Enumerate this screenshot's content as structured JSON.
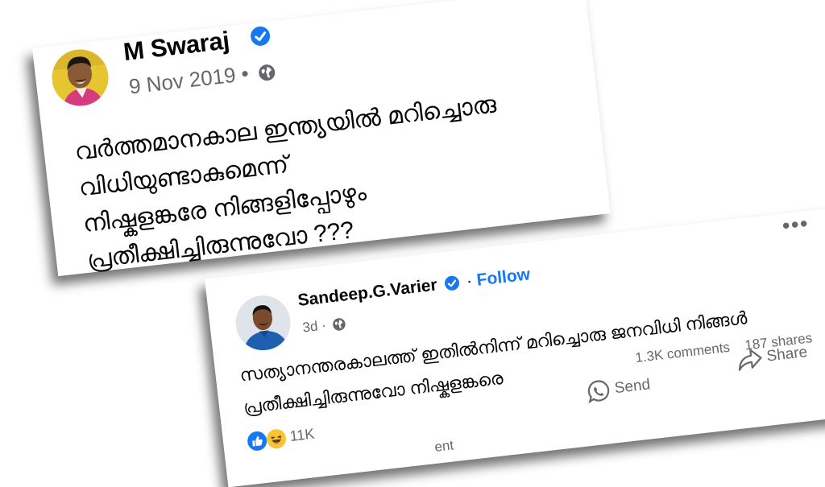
{
  "post1": {
    "author": "M Swaraj",
    "date": "9 Nov 2019",
    "separator": "•",
    "lines": [
      "വർത്തമാനകാല ഇന്ത്യയിൽ മറിച്ചൊരു",
      "വിധിയുണ്ടാകുമെന്ന്",
      "നിഷ്കളങ്കരേ നിങ്ങളിപ്പോഴും",
      "പ്രതീക്ഷിച്ചിരുന്നുവോ ???"
    ]
  },
  "post2": {
    "author": "Sandeep.G.Varier",
    "separator": "·",
    "follow": "Follow",
    "time": "3d",
    "more": "•••",
    "lines": [
      "സത്യാനന്തരകാലത്ത് ഇതിൽനിന്ന് മറിച്ചൊരു ജനവിധി നിങ്ങൾ",
      "പ്രതീക്ഷിച്ചിരുന്നുവോ നിഷ്കളങ്കരെ"
    ],
    "comments": "1.3K comments",
    "shares": "187 shares",
    "reactions_count": "11K",
    "send": "Send",
    "share": "Share",
    "cut_label": "ent"
  },
  "colors": {
    "accent": "#1877f2",
    "secondary_text": "#65676b"
  },
  "icons": [
    "verified-icon",
    "globe-icon",
    "like-icon",
    "haha-icon",
    "messenger-icon",
    "share-icon",
    "more-icon"
  ]
}
